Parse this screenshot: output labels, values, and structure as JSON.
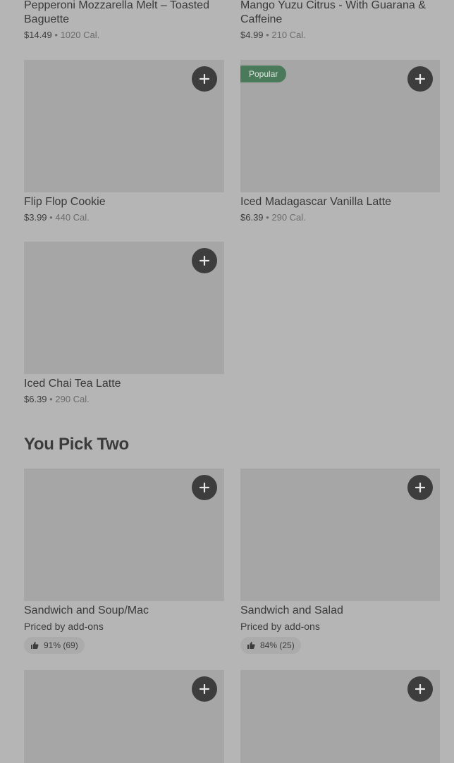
{
  "top_row": [
    {
      "name": "Pepperoni Mozzarella Melt – Toasted Baguette",
      "price": "$14.49",
      "cal": "1020 Cal."
    },
    {
      "name": "Mango Yuzu Citrus - With Guarana & Caffeine",
      "price": "$4.99",
      "cal": "210 Cal."
    }
  ],
  "items": [
    {
      "name": "Flip Flop Cookie",
      "price": "$3.99",
      "cal": "440 Cal."
    },
    {
      "name": "Iced Madagascar Vanilla Latte",
      "price": "$6.39",
      "cal": "290 Cal.",
      "badge": "Popular"
    },
    {
      "name": "Iced Chai Tea Latte",
      "price": "$6.39",
      "cal": "290 Cal."
    }
  ],
  "sections": {
    "you_pick_two": {
      "title": "You Pick Two",
      "items": [
        {
          "name": "Sandwich and Soup/Mac",
          "priced": "Priced by add-ons",
          "rating": "91% (69)"
        },
        {
          "name": "Sandwich and Salad",
          "priced": "Priced by add-ons",
          "rating": "84% (25)"
        }
      ]
    }
  },
  "separator": "•",
  "icons": {
    "add": "plus-icon",
    "thumb": "thumbs-up-icon"
  },
  "colors": {
    "background": "#b5b5b5",
    "placeholder": "#a6a6a6",
    "button": "#3d3d3d",
    "badge": "#4a7a5a"
  }
}
